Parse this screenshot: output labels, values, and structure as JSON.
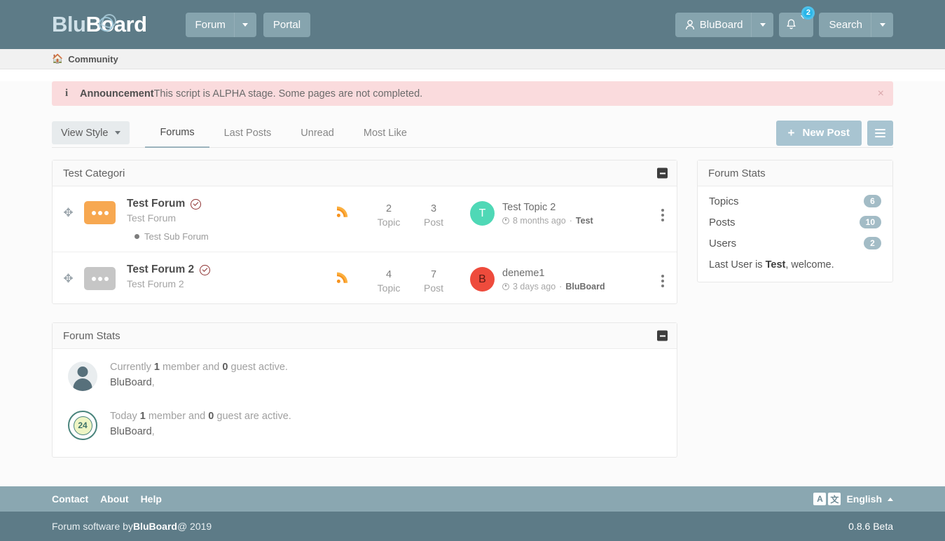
{
  "header": {
    "brand_part1": "Blu",
    "brand_part2": "oard",
    "brand_o": "B",
    "nav": [
      {
        "label": "Forum",
        "has_caret": true
      },
      {
        "label": "Portal",
        "has_caret": false
      }
    ],
    "user_button": "BluBoard",
    "notification_count": "2",
    "search_button": "Search",
    "icons": {
      "user": "user-icon",
      "bell": "bell-icon"
    }
  },
  "breadcrumb": {
    "home_icon": "home-icon",
    "label": "Community"
  },
  "announcement": {
    "title": "Announcement",
    "message": " This script is ALPHA stage. Some pages are not completed.",
    "close": "×"
  },
  "toolbar": {
    "view_style": "View Style",
    "tabs": [
      {
        "label": "Forums",
        "active": true
      },
      {
        "label": "Last Posts",
        "active": false
      },
      {
        "label": "Unread",
        "active": false
      },
      {
        "label": "Most Like",
        "active": false
      }
    ],
    "new_post": "New Post",
    "new_post_plus": "+"
  },
  "category": {
    "title": "Test Categori",
    "forums": [
      {
        "name": "Test Forum",
        "description": "Test Forum",
        "verified": true,
        "bubble_color": "orange",
        "subforum": "Test Sub Forum",
        "topic_count": "2",
        "topic_label": "Topic",
        "post_count": "3",
        "post_label": "Post",
        "last_post_title": "Test Topic 2",
        "last_post_time": "8 months ago",
        "last_post_sep": "·",
        "last_post_author": "Test",
        "avatar_letter": "T",
        "avatar_color": "#4fd8b6"
      },
      {
        "name": "Test Forum 2",
        "description": "Test Forum 2",
        "verified": true,
        "bubble_color": "gray",
        "subforum": null,
        "topic_count": "4",
        "topic_label": "Topic",
        "post_count": "7",
        "post_label": "Post",
        "last_post_title": "deneme1",
        "last_post_time": "3 days ago",
        "last_post_sep": "·",
        "last_post_author": "BluBoard",
        "avatar_letter": "B",
        "avatar_color": "#ee4b3c"
      }
    ]
  },
  "forum_stats_panel": {
    "title": "Forum Stats",
    "current": {
      "prefix": "Currently ",
      "member_count": "1",
      "mid": " member and ",
      "guest_count": "0",
      "suffix": " guest active.",
      "users": "BluBoard",
      "comma": ","
    },
    "today": {
      "prefix": "Today ",
      "member_count": "1",
      "mid": " member and ",
      "guest_count": "0",
      "suffix": " guest are active.",
      "users": "BluBoard",
      "comma": ",",
      "badge": "24"
    }
  },
  "sidebar": {
    "title": "Forum Stats",
    "items": [
      {
        "label": "Topics",
        "value": "6"
      },
      {
        "label": "Posts",
        "value": "10"
      },
      {
        "label": "Users",
        "value": "2"
      }
    ],
    "note_prefix": "Last User is ",
    "note_user": "Test",
    "note_suffix": ", welcome."
  },
  "footer": {
    "links": [
      "Contact",
      "About",
      "Help"
    ],
    "lang_a": "A",
    "lang_glyph": "文",
    "language": "English",
    "copyright_prefix": "Forum software by ",
    "copyright_brand": "BluBoard",
    "copyright_suffix": " @ 2019",
    "version": "0.8.6 Beta"
  },
  "colors": {
    "header_bg": "#5d7b87",
    "accent": "#a8c4d1",
    "announce_bg": "#fadbdd",
    "rss": "#f7931e",
    "footer_links_bg": "#8aa7b1"
  }
}
